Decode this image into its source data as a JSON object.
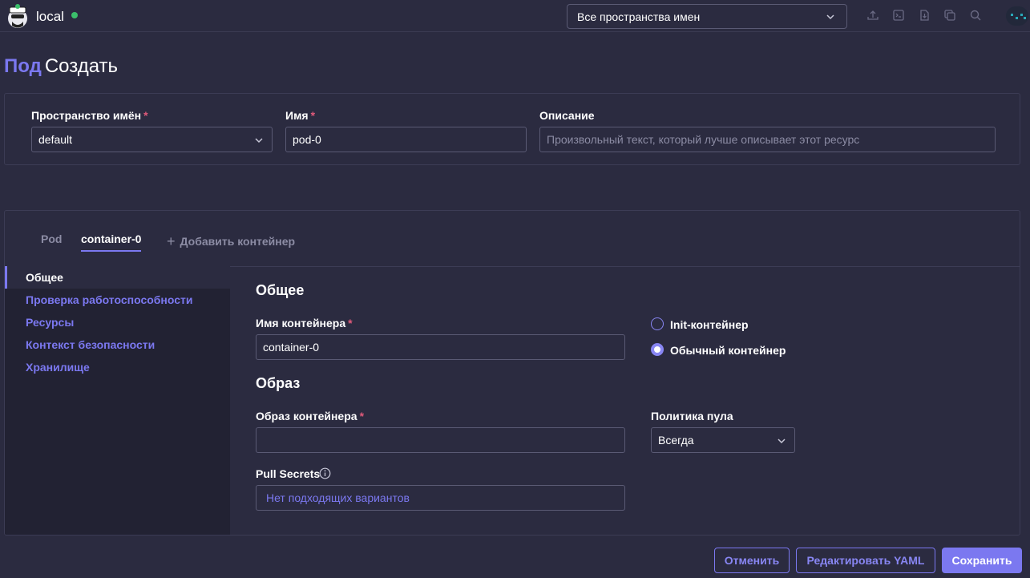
{
  "header": {
    "cluster_name": "local",
    "namespace_filter": "Все пространства имен",
    "icons": [
      "upload-icon",
      "terminal-icon",
      "download-file-icon",
      "copy-icon",
      "search-icon"
    ],
    "status_color": "#3bbf6b"
  },
  "page": {
    "resource": "Под",
    "action": "Создать"
  },
  "meta": {
    "namespace_label": "Пространство имён",
    "namespace_value": "default",
    "name_label": "Имя",
    "name_value": "pod-0",
    "description_label": "Описание",
    "description_placeholder": "Произвольный текст, который лучше описывает этот ресурс",
    "required_mark": "*"
  },
  "tabs": {
    "pod": "Pod",
    "container": "container-0",
    "add": "Добавить контейнер"
  },
  "sidebar": {
    "items": [
      {
        "label": "Общее"
      },
      {
        "label": "Проверка работоспособности"
      },
      {
        "label": "Ресурсы"
      },
      {
        "label": "Контекст безопасности"
      },
      {
        "label": "Хранилище"
      }
    ]
  },
  "general": {
    "title": "Общее",
    "container_name_label": "Имя контейнера",
    "container_name_value": "container-0",
    "radio_init": "Init-контейнер",
    "radio_regular": "Обычный контейнер"
  },
  "image": {
    "title": "Образ",
    "image_label": "Образ контейнера",
    "image_value": "",
    "pull_policy_label": "Политика пула",
    "pull_policy_value": "Всегда",
    "pull_secrets_label": "Pull Secrets",
    "pull_secrets_empty": "Нет подходящих вариантов"
  },
  "footer": {
    "cancel": "Отменить",
    "edit_yaml": "Редактировать YAML",
    "save": "Сохранить"
  },
  "colors": {
    "accent": "#7b78f0",
    "background": "#2b2b40",
    "sidebar_bg": "#222233",
    "required": "#e05a7a"
  }
}
